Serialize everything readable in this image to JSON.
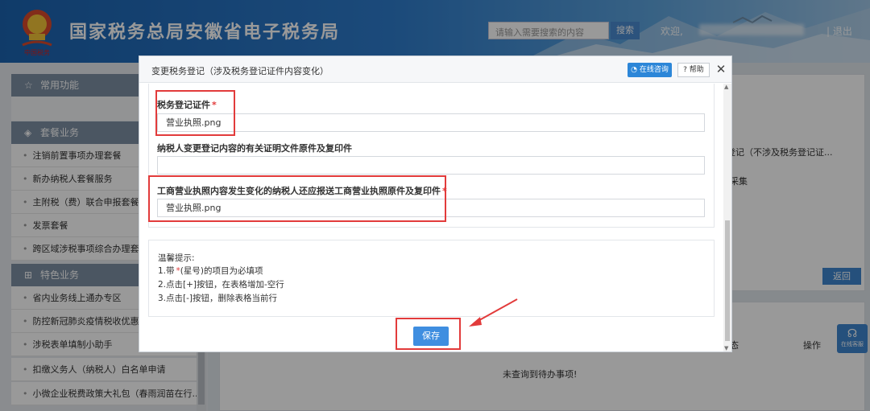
{
  "header": {
    "site_title": "国家税务总局安徽省电子税务局",
    "emblem_text": "中国税务",
    "search_placeholder": "请输入需要搜索的内容",
    "search_button": "搜索",
    "welcome": "欢迎,",
    "logout": "| 退出"
  },
  "sidebar": {
    "sections": [
      {
        "title": "常用功能",
        "icon": "star-icon"
      },
      {
        "title": "套餐业务",
        "icon": "layers-icon"
      },
      {
        "title": "特色业务",
        "icon": "grid-icon"
      }
    ],
    "package_items": [
      "注销前置事项办理套餐",
      "新办纳税人套餐服务",
      "主附税（费）联合申报套餐",
      "发票套餐",
      "跨区域涉税事项综合办理套餐"
    ],
    "feature_items": [
      "省内业务线上通办专区",
      "防控新冠肺炎疫情税收优惠专区",
      "涉税表单填制小助手",
      "扣缴义务人（纳税人）白名单申请",
      "小微企业税费政策大礼包（春雨润苗在行..."
    ]
  },
  "background": {
    "item_text": "登记（不涉及税务登记证...",
    "item_text2": "采集",
    "back_button": "返回",
    "col_status": "态",
    "col_action": "操作",
    "empty_text": "未查询到待办事项!",
    "chat_float": "在线客服"
  },
  "modal": {
    "title": "变更税务登记（涉及税务登记证件内容变化）",
    "consult_button": "在线咨询",
    "help_button": "? 帮助",
    "close": "✕",
    "fields": [
      {
        "label": "税务登记证件",
        "required": "*",
        "value": "营业执照.png"
      },
      {
        "label": "纳税人变更登记内容的有关证明文件原件及复印件",
        "value": ""
      },
      {
        "label": "工商营业执照内容发生变化的纳税人还应报送工商营业执照原件及复印件",
        "required": "*",
        "value": "营业执照.png"
      }
    ],
    "tips": {
      "title": "温馨提示:",
      "line1_prefix": "1.带",
      "line1_star": "*",
      "line1_suffix": "(星号)的项目为必填项",
      "line2": "2.点击[+]按钮，在表格增加-空行",
      "line3": "3.点击[-]按钮，删除表格当前行"
    },
    "save_button": "保存"
  },
  "colors": {
    "header_blue": "#1b63b0",
    "button_blue": "#3f8ee0",
    "required_red": "#e23b3b",
    "annotation_red": "#e23b3b"
  }
}
